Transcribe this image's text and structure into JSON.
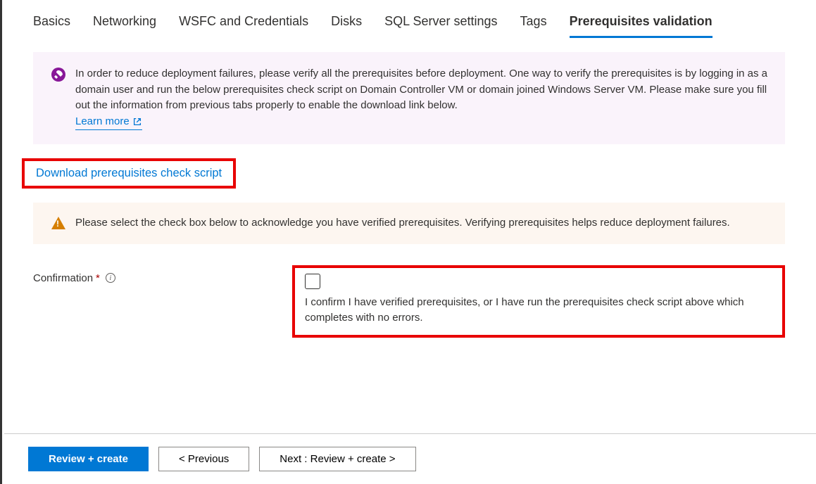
{
  "tabs": [
    {
      "label": "Basics"
    },
    {
      "label": "Networking"
    },
    {
      "label": "WSFC and Credentials"
    },
    {
      "label": "Disks"
    },
    {
      "label": "SQL Server settings"
    },
    {
      "label": "Tags"
    },
    {
      "label": "Prerequisites validation"
    }
  ],
  "infoBanner": {
    "text": "In order to reduce deployment failures, please verify all the prerequisites before deployment. One way to verify the prerequisites is by logging in as a domain user and run the below prerequisites check script on Domain Controller VM or domain joined Windows Server VM. Please make sure you fill out the information from previous tabs properly to enable the download link below.",
    "learnMore": "Learn more"
  },
  "downloadLink": "Download prerequisites check script",
  "warningBanner": {
    "text": "Please select the check box below to acknowledge you have verified prerequisites. Verifying prerequisites helps reduce deployment failures."
  },
  "confirmation": {
    "label": "Confirmation",
    "required": "*",
    "checkboxText": "I confirm I have verified prerequisites, or I have run the prerequisites check script above which completes with no errors."
  },
  "footer": {
    "reviewCreate": "Review + create",
    "previous": "< Previous",
    "next": "Next : Review + create >"
  }
}
